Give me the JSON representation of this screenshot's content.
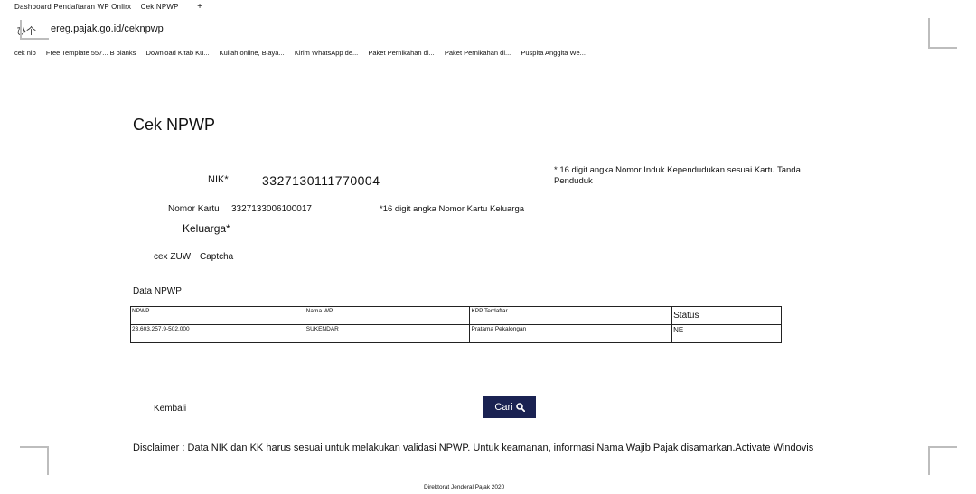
{
  "browser": {
    "tabs": [
      "Dashboard Pendaftaran WP Onlirx",
      "Cek NPWP"
    ],
    "new_tab": "+",
    "nav_icons": "ひ个",
    "url": "ereg.pajak.go.id/ceknpwp",
    "bookmarks": [
      "cek nib",
      "Free Template 557... B blanks",
      "Download Kitab Ku...",
      "Kuliah online, Biaya...",
      "Kirim WhatsApp de...",
      "Paket Pernikahan di...",
      "Paket Pernikahan di...",
      "Puspita Anggita We..."
    ]
  },
  "page": {
    "title": "Cek NPWP",
    "nik": {
      "label": "NIK*",
      "value": "3327130111770004",
      "hint": "* 16 digit angka Nomor Induk Kependudukan sesuai Kartu Tanda Penduduk"
    },
    "kk": {
      "label_line1": "Nomor Kartu",
      "label_line2": "Keluarga*",
      "value": "3327133006100017",
      "hint": "*16 digit angka Nomor Kartu Keluarga"
    },
    "captcha": {
      "code": "cex ZUW",
      "label": "Captcha"
    },
    "data_section": {
      "title": "Data NPWP",
      "headers": [
        "NPWP",
        "Nama WP",
        "KPP Terdaftar",
        "Status"
      ],
      "rows": [
        [
          "23.603.257.9-502.000",
          "SUKENDAR",
          "Pratama Pekalongan",
          "NE"
        ]
      ]
    },
    "back_label": "Kembali",
    "search_label": "Cari",
    "disclaimer": "Disclaimer : Data NIK dan KK harus sesuai untuk melakukan validasi NPWP. Untuk keamanan, informasi Nama Wajib Pajak disamarkan.Activate Windovis",
    "footer": "Direktorat Jenderal Pajak 2020"
  },
  "colors": {
    "button_bg": "#1a2252",
    "button_text": "#ffffff"
  }
}
